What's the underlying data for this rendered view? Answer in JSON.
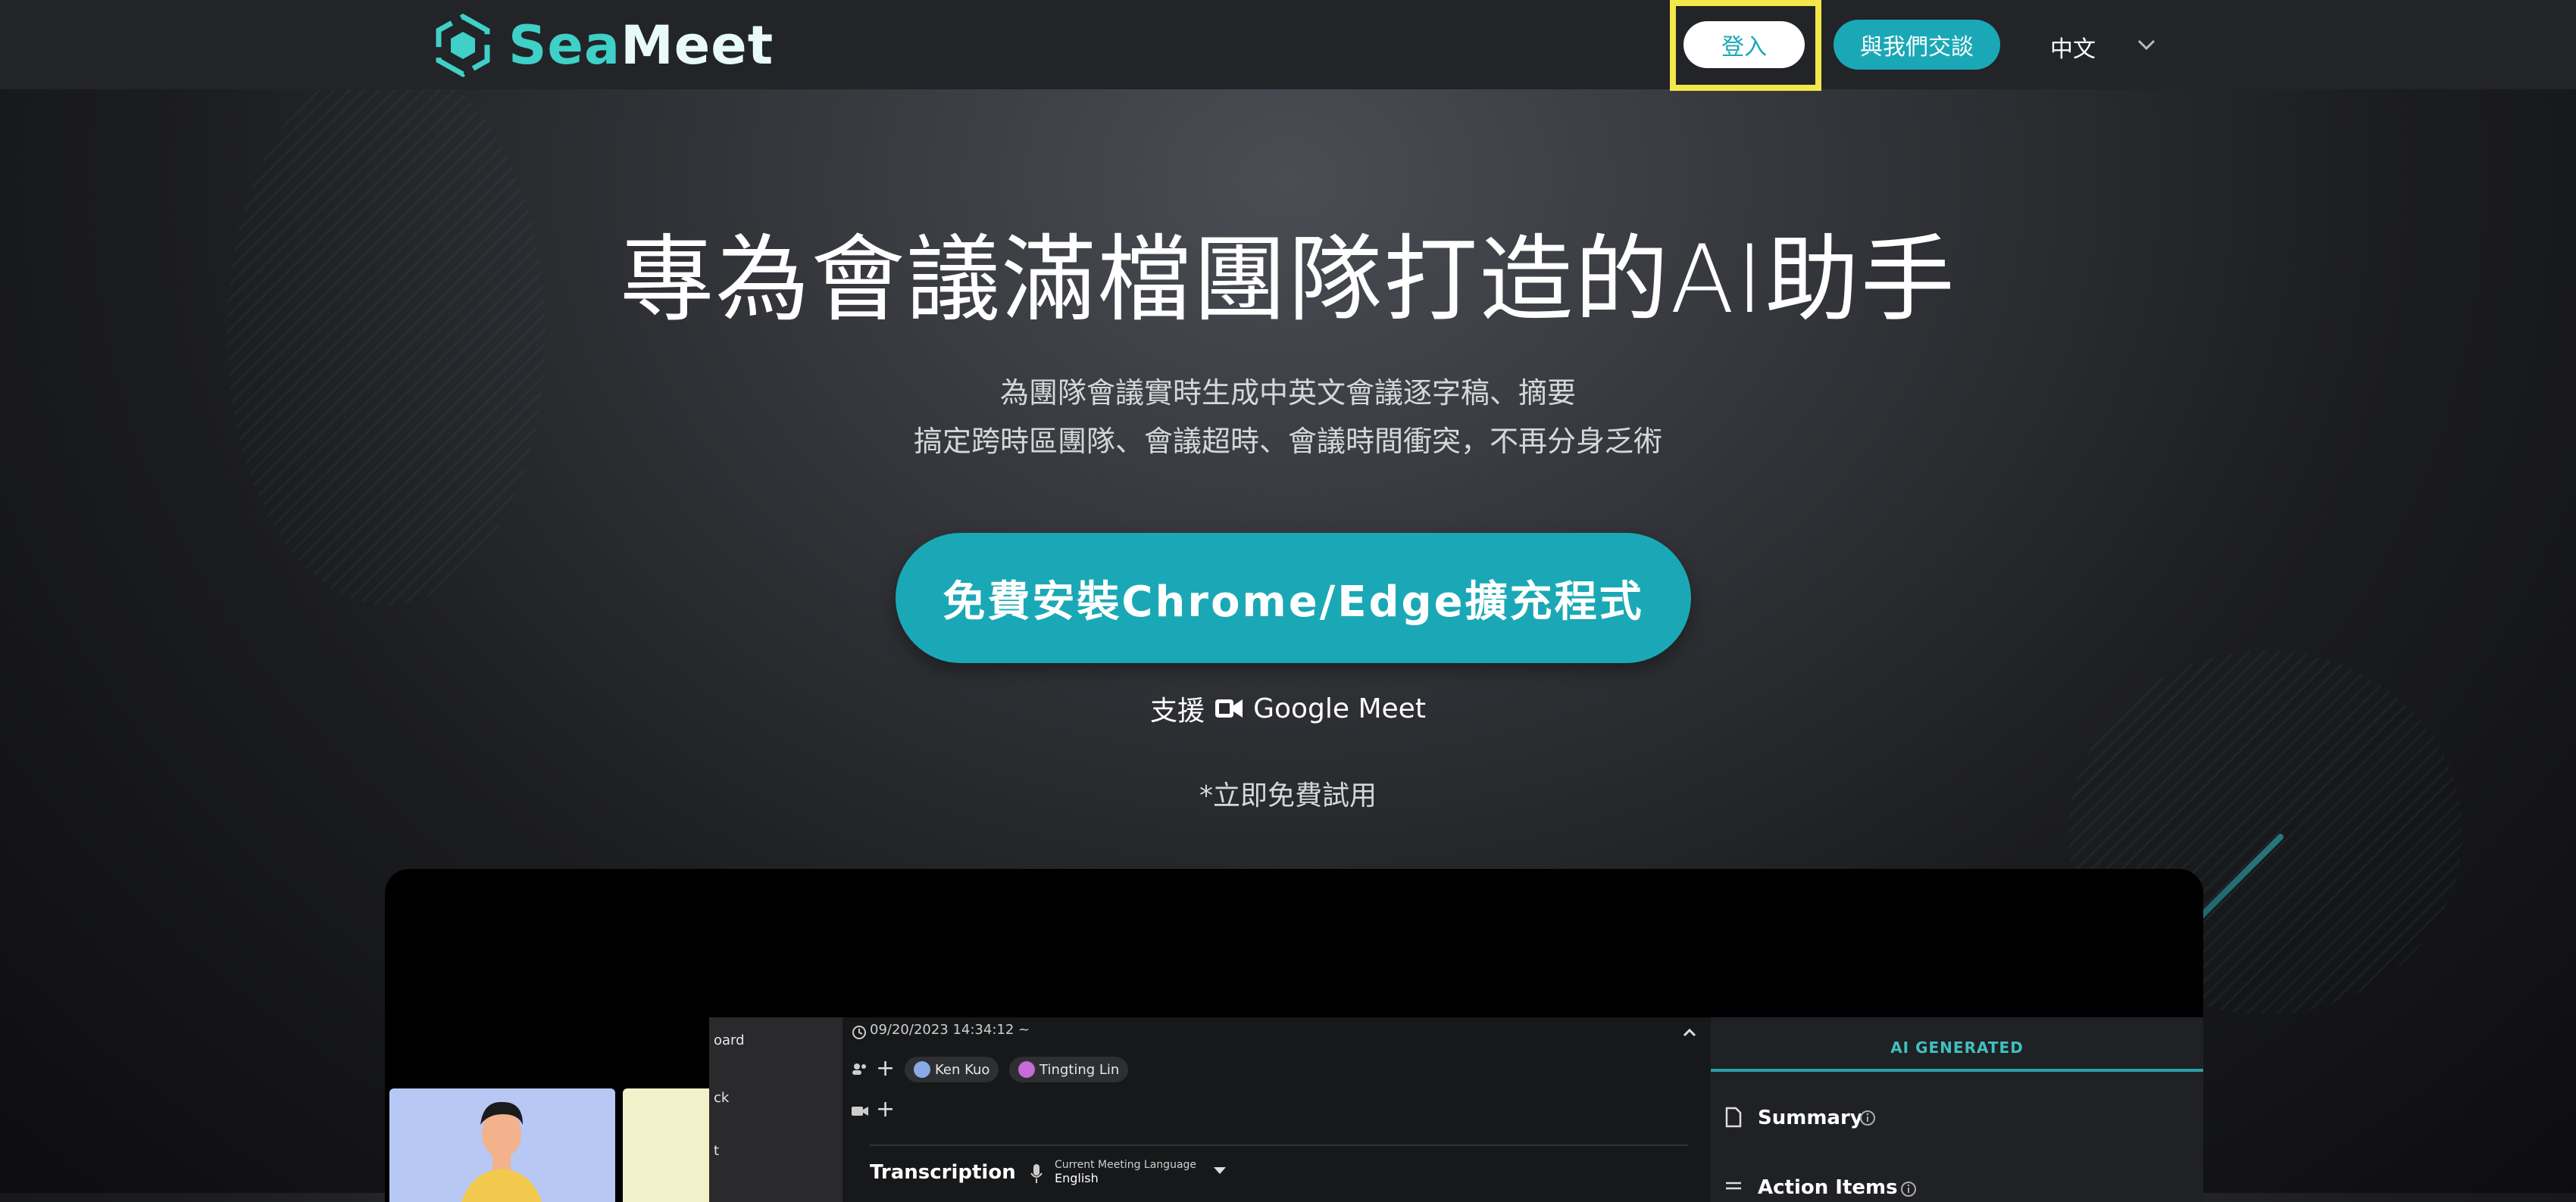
{
  "header": {
    "logo_text_a": "Sea",
    "logo_text_b": "Meet",
    "login_label": "登入",
    "talk_label": "與我們交談",
    "language": "中文"
  },
  "hero": {
    "title": "專為會議滿檔團隊打造的AI助手",
    "subtitle_line1": "為團隊會議實時生成中英文會議逐字稿、摘要",
    "subtitle_line2": "搞定跨時區團隊、會議超時、會議時間衝突，不再分身乏術",
    "cta_label": "免費安裝Chrome/Edge擴充程式",
    "support_prefix": "支援",
    "support_product": "Google Meet",
    "trial_note": "*立即免費試用"
  },
  "preview": {
    "sidebar_items": [
      "oard",
      "ck",
      "t"
    ],
    "timestamp": "09/20/2023 14:34:12 ~",
    "participants": [
      "Ken Kuo",
      "Tingting Lin"
    ],
    "transcription_label": "Transcription",
    "language_caption": "Current Meeting Language",
    "language_value": "English",
    "ai_generated_label": "AI GENERATED",
    "summary_label": "Summary",
    "action_items_label": "Action Items"
  },
  "colors": {
    "accent": "#1aa8b6",
    "logo": "#3fd0c8",
    "highlight": "#f3e84b"
  }
}
